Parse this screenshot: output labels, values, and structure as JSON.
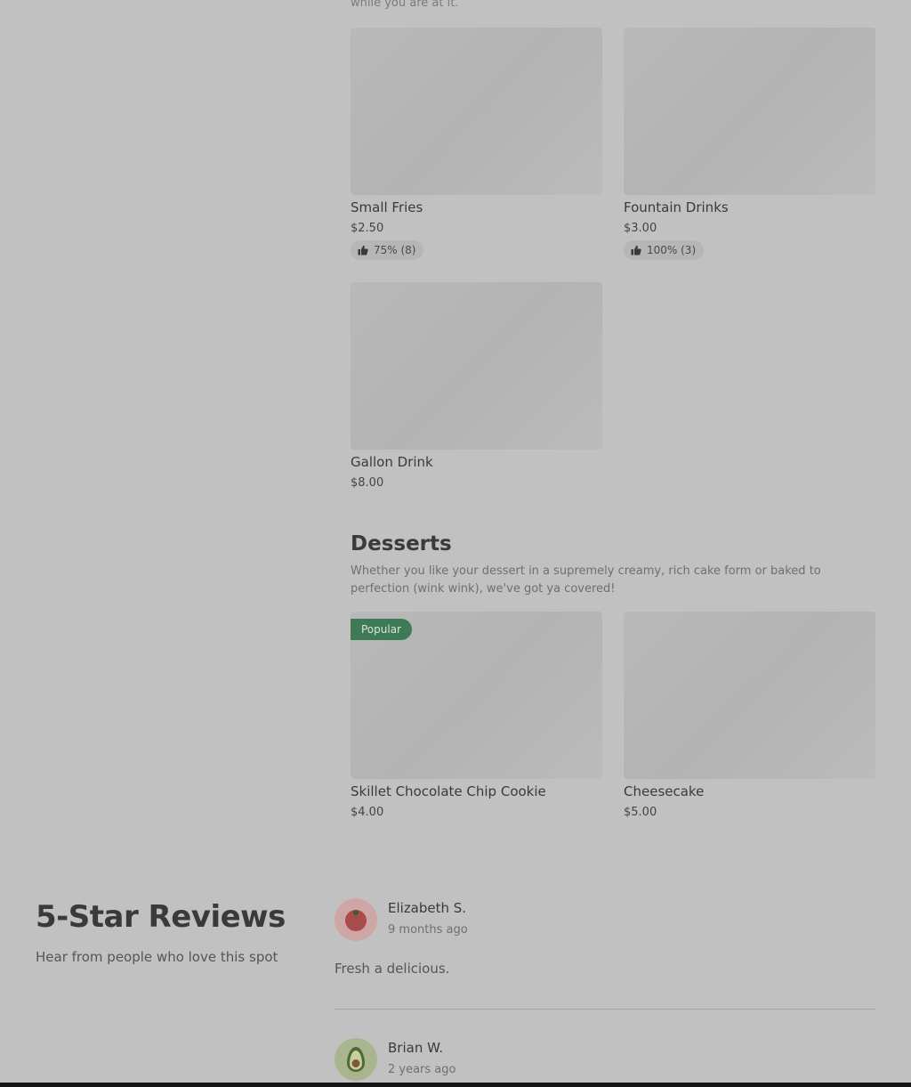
{
  "drinks_section": {
    "note": "while you are at it."
  },
  "drinks": [
    {
      "name": "Small Fries",
      "price": "$2.50",
      "rating": "75% (8)"
    },
    {
      "name": "Fountain Drinks",
      "price": "$3.00",
      "rating": "100% (3)"
    },
    {
      "name": "Gallon Drink",
      "price": "$8.00"
    }
  ],
  "desserts": {
    "title": "Desserts",
    "description": "Whether you like your dessert in a supremely creamy, rich cake form or baked to perfection (wink wink), we've got ya covered!",
    "items": [
      {
        "name": "Skillet Chocolate Chip Cookie",
        "price": "$4.00",
        "badge": "Popular"
      },
      {
        "name": "Cheesecake",
        "price": "$5.00"
      }
    ]
  },
  "reviews": {
    "title": "5-Star Reviews",
    "subtitle": "Hear from people who love this spot",
    "items": [
      {
        "name": "Elizabeth S.",
        "time": "9 months ago",
        "text": "Fresh a delicious.",
        "avatar_icon": "tomato-icon"
      },
      {
        "name": "Brian W.",
        "time": "2 years ago",
        "avatar_icon": "avocado-icon"
      }
    ]
  },
  "colors": {
    "overlay_bg": "#c1c1c1",
    "popular_badge": "#3f7a56"
  }
}
